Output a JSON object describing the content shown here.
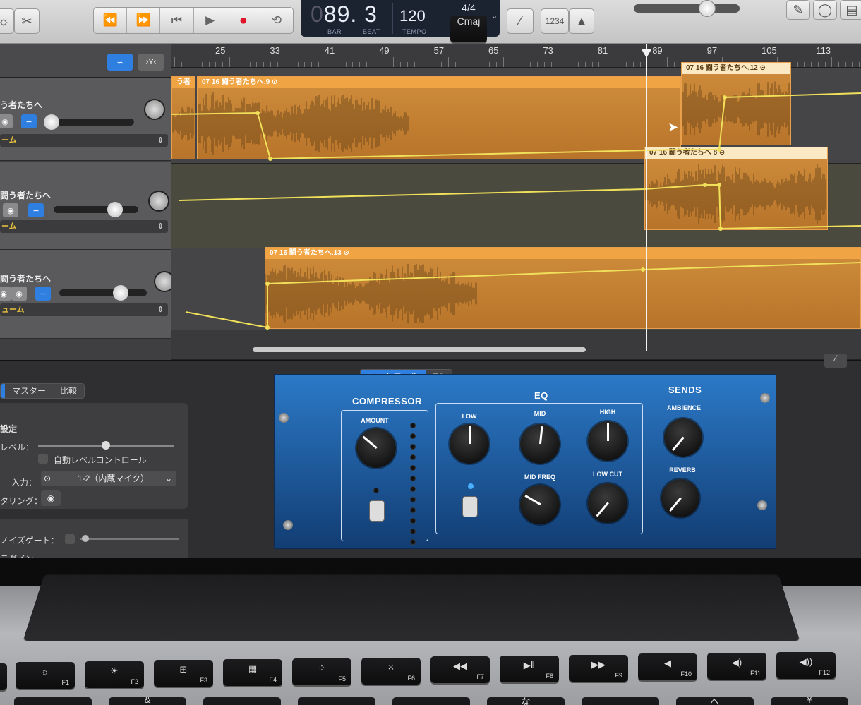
{
  "toolbar": {
    "transport": [
      "⏪",
      "⏩",
      "⏮",
      "▶",
      "●",
      "⟲"
    ],
    "lcd": {
      "position": "89. 3",
      "position_prefix": "0",
      "bar_label": "BAR",
      "beat_label": "BEAT",
      "tempo": "120",
      "tempo_label": "TEMPO",
      "time_signature": "4/4",
      "key": "Cmaj"
    },
    "count_in": "1234",
    "icons": [
      "scissors-icon",
      "tuner-icon",
      "metronome-icon",
      "notepad-icon",
      "loop-browser-icon",
      "media-browser-icon"
    ]
  },
  "ruler": {
    "bars": [
      "25",
      "33",
      "41",
      "49",
      "57",
      "65",
      "73",
      "81",
      "89",
      "97",
      "105",
      "113"
    ]
  },
  "tracks": [
    {
      "name": "う者たちへ",
      "automation": "ーム"
    },
    {
      "name": "闘う者たちへ",
      "automation": "ーム"
    },
    {
      "name": "闘う者たちへ",
      "automation": "ューム"
    }
  ],
  "regions": [
    {
      "title": "う者",
      "selected": false
    },
    {
      "title": "07 16  闘う者たちへ.9  ⊙",
      "selected": false
    },
    {
      "title": "07 16  闘う者たちへ.12  ⊙",
      "selected": true
    },
    {
      "title": "07 16  闘う者たちへ 8  ⊙",
      "selected": true
    },
    {
      "title": "07 16  闘う者たちへ.13  ⊙",
      "selected": false
    }
  ],
  "smart_controls": {
    "tabs": [
      "コントロール",
      "EQ"
    ],
    "left_tabs": [
      "マスター",
      "比較"
    ],
    "settings_title": "設定",
    "level_label": "レベル：",
    "auto_level": "自動レベルコントロール",
    "input_label": "入力：",
    "input_value": "1-2（内蔵マイク）",
    "monitoring_label": "タリング：",
    "noise_gate": "ノイズゲート：",
    "plugin": "ラグイン"
  },
  "plugin": {
    "compressor_title": "COMPRESSOR",
    "amount": "AMOUNT",
    "eq_title": "EQ",
    "low": "LOW",
    "mid": "MID",
    "high": "HIGH",
    "mid_freq": "MID FREQ",
    "low_cut": "LOW CUT",
    "sends_title": "SENDS",
    "ambience": "AMBIENCE",
    "reverb": "REVERB"
  },
  "keyboard": {
    "fkeys": [
      {
        "sym": "☼",
        "fn": "F1"
      },
      {
        "sym": "☀",
        "fn": "F2"
      },
      {
        "sym": "⊞",
        "fn": "F3"
      },
      {
        "sym": "▦",
        "fn": "F4"
      },
      {
        "sym": "⁘",
        "fn": "F5"
      },
      {
        "sym": "⁙",
        "fn": "F6"
      },
      {
        "sym": "◀◀",
        "fn": "F7"
      },
      {
        "sym": "▶Ⅱ",
        "fn": "F8"
      },
      {
        "sym": "▶▶",
        "fn": "F9"
      },
      {
        "sym": "◀",
        "fn": "F10"
      },
      {
        "sym": "◀)",
        "fn": "F11"
      },
      {
        "sym": "◀))",
        "fn": "F12"
      }
    ],
    "row2": [
      "",
      "&",
      "",
      "",
      "",
      "な",
      "",
      "へ",
      "¥"
    ]
  },
  "colors": {
    "region": "#c8822f",
    "region_title": "#f0a444",
    "automation": "#f0e05a",
    "plugin_blue": "#2169b3",
    "accent": "#2f7fe0"
  }
}
